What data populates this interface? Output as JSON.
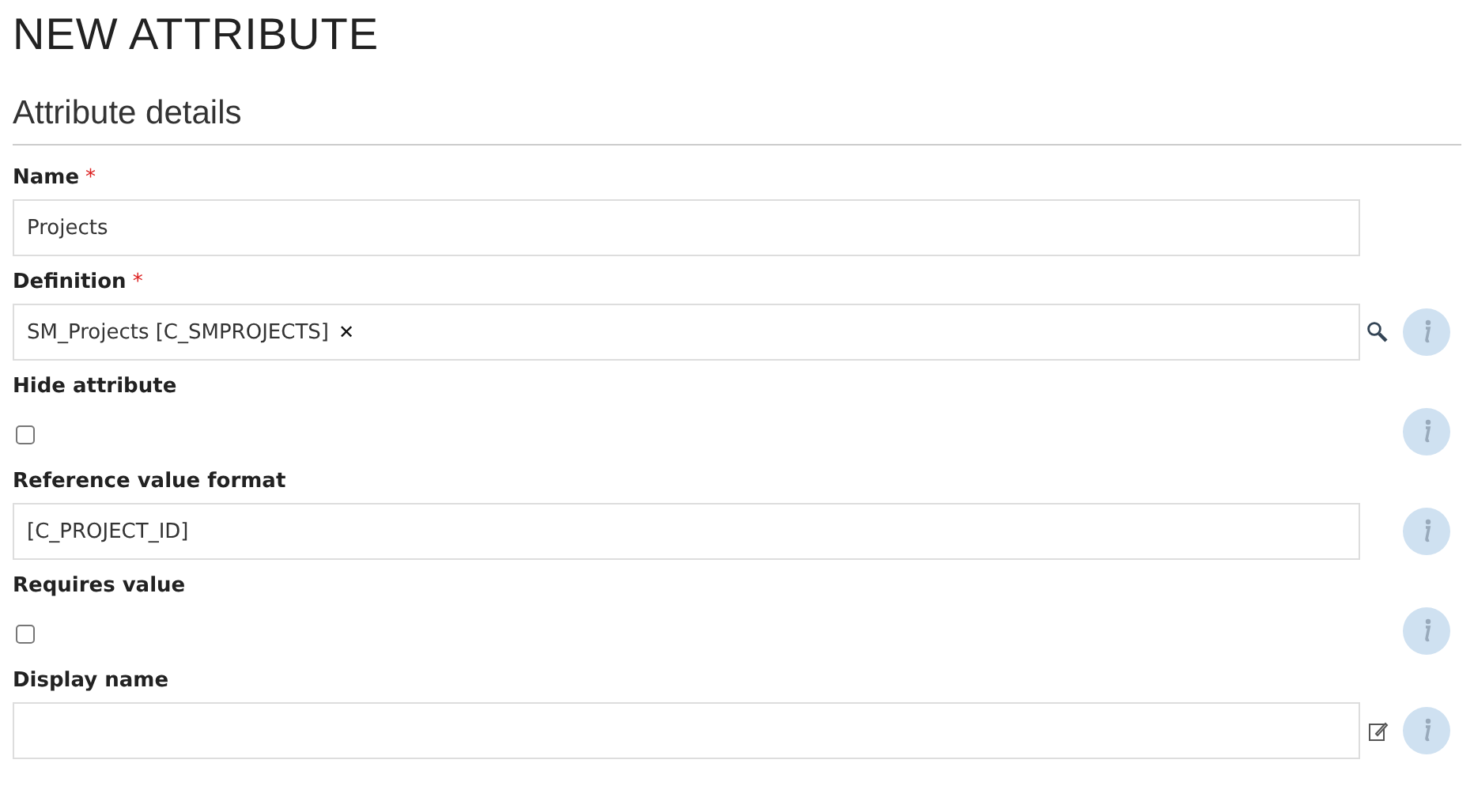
{
  "page_title": "NEW ATTRIBUTE",
  "section": {
    "title": "Attribute details"
  },
  "fields": [
    {
      "kind": "text",
      "label": "Name",
      "required_mark": "*",
      "value": "Projects",
      "info": false
    },
    {
      "kind": "lookup",
      "label": "Definition",
      "required_mark": "*",
      "value": "SM_Projects [C_SMPROJECTS]",
      "clear": "✕",
      "info": true
    },
    {
      "kind": "checkbox",
      "label": "Hide attribute",
      "checked": false,
      "info": true
    },
    {
      "kind": "text",
      "label": "Reference value format",
      "value": "[C_PROJECT_ID]",
      "info": true
    },
    {
      "kind": "checkbox",
      "label": "Requires value",
      "checked": false,
      "info": true
    },
    {
      "kind": "translatable",
      "label": "Display name",
      "info": true
    }
  ]
}
